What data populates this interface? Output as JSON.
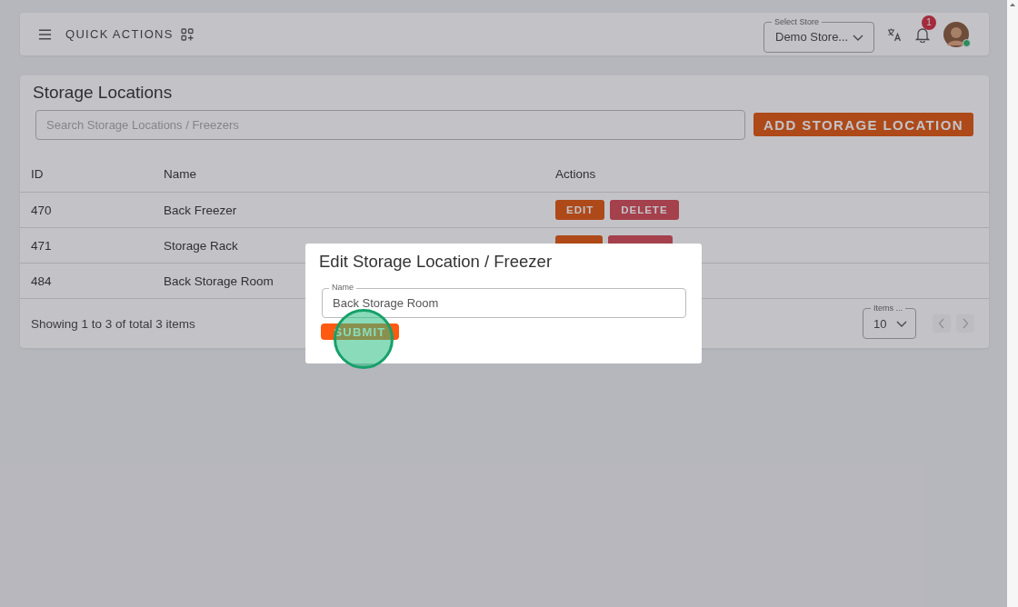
{
  "header": {
    "quick_actions": "QUICK ACTIONS",
    "store_select": {
      "label": "Select Store",
      "value": "Demo Store..."
    },
    "notifications": {
      "count": "1"
    },
    "avatar": {
      "online": true
    }
  },
  "page": {
    "title": "Storage Locations",
    "search": {
      "placeholder": "Search Storage Locations / Freezers"
    },
    "add_button": "ADD STORAGE LOCATION"
  },
  "table": {
    "columns": [
      "ID",
      "Name",
      "Actions"
    ],
    "rows": [
      {
        "id": "470",
        "name": "Back Freezer",
        "actions": [
          {
            "kind": "edit",
            "label": "EDIT"
          },
          {
            "kind": "delete",
            "label": "DELETE"
          }
        ]
      },
      {
        "id": "471",
        "name": "Storage Rack",
        "actions": [
          {
            "kind": "edit"
          },
          {
            "kind": "delete"
          }
        ]
      },
      {
        "id": "484",
        "name": "Back Storage Room",
        "actions": []
      }
    ]
  },
  "footer": {
    "summary": "Showing 1 to 3 of total 3 items",
    "items_select": {
      "label": "Items ...",
      "value": "10"
    },
    "prev_disabled": true,
    "next_disabled": true
  },
  "dialog": {
    "title": "Edit Storage Location / Freezer",
    "field": {
      "label": "Name",
      "value": "Back Storage Room"
    },
    "submit": "SUBMIT",
    "click_marker": true
  }
}
